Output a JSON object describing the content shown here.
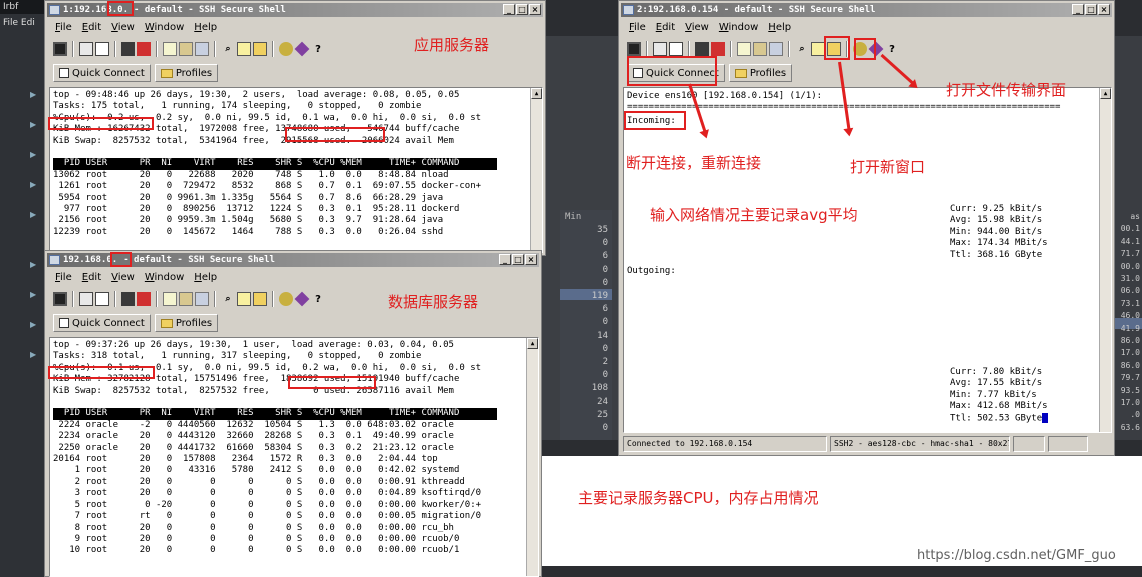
{
  "background": {
    "left_title": "Irbf",
    "left_menu": "File Edi",
    "min_label": "Min",
    "mid_numbers": [
      "35",
      "0",
      "6",
      "0",
      "0",
      "119",
      "6",
      "0",
      "14",
      "0",
      "2",
      "0",
      "108",
      "24",
      "25",
      "0"
    ],
    "right_numbers": [
      "as",
      "00.1",
      "44.1",
      "71.7",
      "00.0",
      "31.0",
      "06.0",
      "73.1",
      "46.0",
      "41.9",
      "86.0",
      "17.0",
      "86.0",
      "79.7",
      "93.5",
      "17.0",
      ".0",
      "63.6"
    ]
  },
  "app_server": {
    "title_prefix": "1:192.168.0.",
    "title_suffix": "- default - SSH Secure Shell",
    "menu": [
      "File",
      "Edit",
      "View",
      "Window",
      "Help"
    ],
    "quick_connect": "Quick Connect",
    "profiles": "Profiles",
    "terminal": {
      "l1": "top - 09:48:46 up 26 days, 19:30,  2 users,  load average: 0.08, 0.05, 0.05",
      "l2": "Tasks: 175 total,   1 running, 174 sleeping,   0 stopped,   0 zombie",
      "l3": "%Cpu(s):  0.2 us,  0.2 sy,  0.0 ni, 99.5 id,  0.1 wa,  0.0 hi,  0.0 si,  0.0 st",
      "l4": "KiB Mem : 16267432 total,  1972008 free, 13748680 used,   546744 buff/cache",
      "l5": "KiB Swap:  8257532 total,  5341964 free,  2915568 used.  2066024 avail Mem",
      "l6": "",
      "header": "  PID USER      PR  NI    VIRT    RES    SHR S  %CPU %MEM     TIME+ COMMAND       ",
      "rows": [
        "13062 root      20   0   22688   2020    748 S   1.0  0.0   8:48.84 nload",
        " 1261 root      20   0  729472   8532    868 S   0.7  0.1  69:07.55 docker-con+",
        " 5954 root      20   0 9961.3m 1.335g   5564 S   0.7  8.6  66:28.29 java",
        "  977 root      20   0  890256  13712   1224 S   0.3  0.1  95:28.11 dockerd",
        " 2156 root      20   0 9959.3m 1.504g   5680 S   0.3  9.7  91:28.64 java",
        "12239 root      20   0  145672   1464    788 S   0.3  0.0   0:26.04 sshd"
      ]
    }
  },
  "db_server": {
    "title_prefix": "192.168.0.",
    "title_suffix": "- default - SSH Secure Shell",
    "menu": [
      "File",
      "Edit",
      "View",
      "Window",
      "Help"
    ],
    "quick_connect": "Quick Connect",
    "profiles": "Profiles",
    "terminal": {
      "l1": "top - 09:37:26 up 26 days, 19:30,  1 user,  load average: 0.03, 0.04, 0.05",
      "l2": "Tasks: 318 total,   1 running, 317 sleeping,   0 stopped,   0 zombie",
      "l3": "%Cpu(s):  0.1 us,  0.1 sy,  0.0 ni, 99.5 id,  0.2 wa,  0.0 hi,  0.0 si,  0.0 st",
      "l4": "KiB Mem : 32782128 total, 15751496 free,  1838692 used, 15191940 buff/cache",
      "l5": "KiB Swap:  8257532 total,  8257532 free,        0 used. 26587116 avail Mem",
      "l6": "",
      "header": "  PID USER      PR  NI    VIRT    RES    SHR S  %CPU %MEM     TIME+ COMMAND       ",
      "rows": [
        " 2224 oracle    -2   0 4440560  12632  10504 S   1.3  0.0 648:03.02 oracle",
        " 2234 oracle    20   0 4443120  32660  28268 S   0.3  0.1  49:40.99 oracle",
        " 2250 oracle    20   0 4441732  61660  58304 S   0.3  0.2  21:23.12 oracle",
        "20164 root      20   0  157808   2364   1572 R   0.3  0.0   2:04.44 top",
        "    1 root      20   0   43316   5780   2412 S   0.0  0.0   0:42.02 systemd",
        "    2 root      20   0       0      0      0 S   0.0  0.0   0:00.91 kthreadd",
        "    3 root      20   0       0      0      0 S   0.0  0.0   0:04.89 ksoftirqd/0",
        "    5 root       0 -20       0      0      0 S   0.0  0.0   0:00.00 kworker/0:+",
        "    7 root      rt   0       0      0      0 S   0.0  0.0   0:00.05 migration/0",
        "    8 root      20   0       0      0      0 S   0.0  0.0   0:00.00 rcu_bh",
        "    9 root      20   0       0      0      0 S   0.0  0.0   0:00.00 rcuob/0",
        "   10 root      20   0       0      0      0 S   0.0  0.0   0:00.00 rcuob/1"
      ]
    }
  },
  "net_window": {
    "title": "2:192.168.0.154 - default - SSH Secure Shell",
    "menu": [
      "File",
      "Edit",
      "View",
      "Window",
      "Help"
    ],
    "quick_connect": "Quick Connect",
    "profiles": "Profiles",
    "terminal": {
      "device": "Device ens160 [192.168.0.154] (1/1):",
      "dashes": "================================================================================",
      "incoming": "Incoming:",
      "in_stats": [
        "Curr: 9.25 kBit/s",
        "Avg: 15.98 kBit/s",
        "Min: 944.00 Bit/s",
        "Max: 174.34 MBit/s",
        "Ttl: 368.16 GByte"
      ],
      "outgoing": "Outgoing:",
      "out_stats": [
        "Curr: 7.80 kBit/s",
        "Avg: 17.55 kBit/s",
        "Min: 7.77 kBit/s",
        "Max: 412.68 MBit/s",
        "Ttl: 502.53 GByte"
      ]
    },
    "status": {
      "connected": "Connected to 192.168.0.154",
      "cipher": "SSH2 - aes128-cbc - hmac-sha1 - 80x27"
    }
  },
  "annotations": {
    "app_server": "应用服务器",
    "db_server": "数据库服务器",
    "open_file_transfer": "打开文件传输界面",
    "reconnect": "断开连接，重新连接",
    "new_window": "打开新窗口",
    "net_note": "输入网络情况主要记录avg平均",
    "main_note": "主要记录服务器CPU，内存占用情况"
  },
  "watermark": "https://blog.csdn.net/GMF_guo"
}
